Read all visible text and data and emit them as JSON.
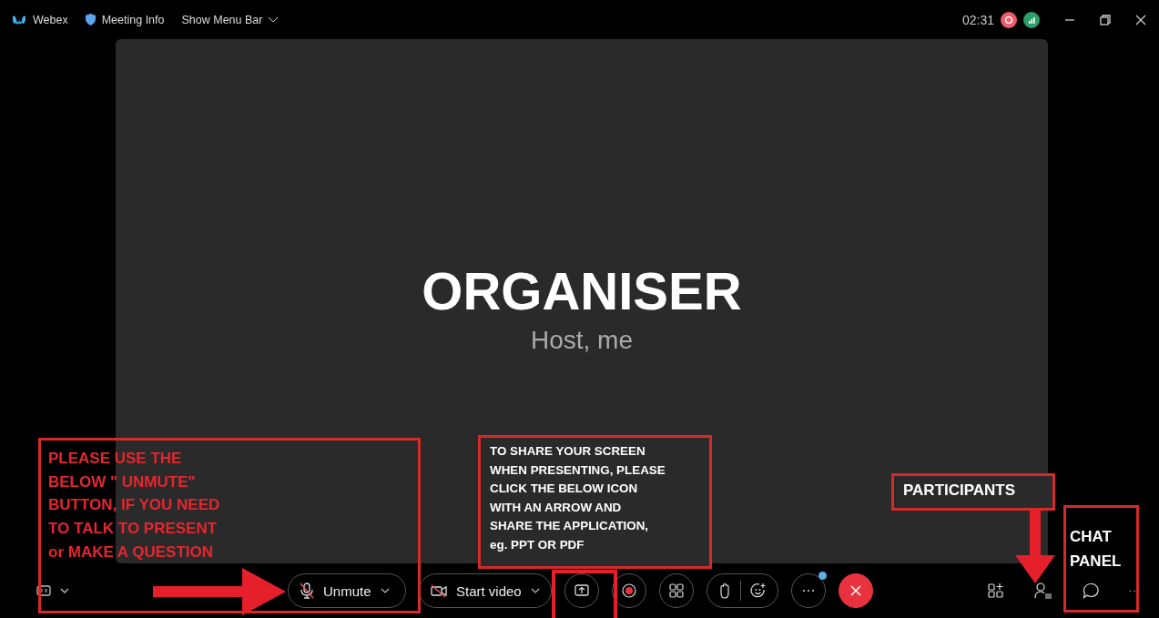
{
  "window": {
    "app_name": "Webex",
    "meeting_info": "Meeting Info",
    "menu_toggle": "Show Menu Bar",
    "timer": "02:31"
  },
  "stage": {
    "name": "ORGANISER",
    "role": "Host, me"
  },
  "toolbar": {
    "mute_button": {
      "label": "Unmute",
      "muted": true
    },
    "video_button": {
      "label": "Start video",
      "video_off": true
    },
    "more_button": {
      "notification": true
    }
  },
  "annotations": [
    {
      "kind": "red-note",
      "text": "PLEASE USE THE\nBELOW \" UNMUTE\"\nBUTTON, IF YOU NEED\nTO TALK TO PRESENT\nor MAKE A QUESTION"
    },
    {
      "kind": "white-note",
      "text": "TO SHARE YOUR SCREEN\nWHEN PRESENTING, PLEASE\nCLICK THE BELOW ICON\nWITH AN ARROW AND\nSHARE THE APPLICATION,\neg. PPT OR PDF"
    },
    {
      "kind": "label",
      "text": "PARTICIPANTS"
    },
    {
      "kind": "label-tall",
      "text": "CHAT\nPANEL"
    }
  ]
}
